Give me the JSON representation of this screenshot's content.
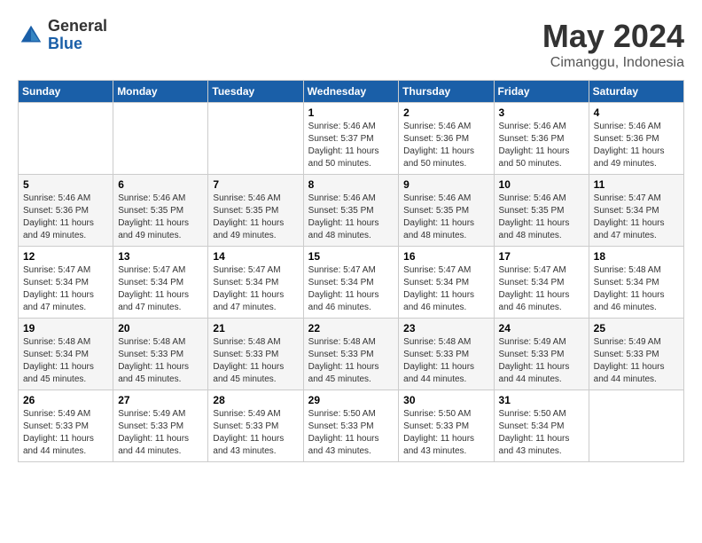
{
  "header": {
    "logo_general": "General",
    "logo_blue": "Blue",
    "month_title": "May 2024",
    "location": "Cimanggu, Indonesia"
  },
  "days_of_week": [
    "Sunday",
    "Monday",
    "Tuesday",
    "Wednesday",
    "Thursday",
    "Friday",
    "Saturday"
  ],
  "weeks": [
    [
      {
        "day": "",
        "info": ""
      },
      {
        "day": "",
        "info": ""
      },
      {
        "day": "",
        "info": ""
      },
      {
        "day": "1",
        "info": "Sunrise: 5:46 AM\nSunset: 5:37 PM\nDaylight: 11 hours\nand 50 minutes."
      },
      {
        "day": "2",
        "info": "Sunrise: 5:46 AM\nSunset: 5:36 PM\nDaylight: 11 hours\nand 50 minutes."
      },
      {
        "day": "3",
        "info": "Sunrise: 5:46 AM\nSunset: 5:36 PM\nDaylight: 11 hours\nand 50 minutes."
      },
      {
        "day": "4",
        "info": "Sunrise: 5:46 AM\nSunset: 5:36 PM\nDaylight: 11 hours\nand 49 minutes."
      }
    ],
    [
      {
        "day": "5",
        "info": "Sunrise: 5:46 AM\nSunset: 5:36 PM\nDaylight: 11 hours\nand 49 minutes."
      },
      {
        "day": "6",
        "info": "Sunrise: 5:46 AM\nSunset: 5:35 PM\nDaylight: 11 hours\nand 49 minutes."
      },
      {
        "day": "7",
        "info": "Sunrise: 5:46 AM\nSunset: 5:35 PM\nDaylight: 11 hours\nand 49 minutes."
      },
      {
        "day": "8",
        "info": "Sunrise: 5:46 AM\nSunset: 5:35 PM\nDaylight: 11 hours\nand 48 minutes."
      },
      {
        "day": "9",
        "info": "Sunrise: 5:46 AM\nSunset: 5:35 PM\nDaylight: 11 hours\nand 48 minutes."
      },
      {
        "day": "10",
        "info": "Sunrise: 5:46 AM\nSunset: 5:35 PM\nDaylight: 11 hours\nand 48 minutes."
      },
      {
        "day": "11",
        "info": "Sunrise: 5:47 AM\nSunset: 5:34 PM\nDaylight: 11 hours\nand 47 minutes."
      }
    ],
    [
      {
        "day": "12",
        "info": "Sunrise: 5:47 AM\nSunset: 5:34 PM\nDaylight: 11 hours\nand 47 minutes."
      },
      {
        "day": "13",
        "info": "Sunrise: 5:47 AM\nSunset: 5:34 PM\nDaylight: 11 hours\nand 47 minutes."
      },
      {
        "day": "14",
        "info": "Sunrise: 5:47 AM\nSunset: 5:34 PM\nDaylight: 11 hours\nand 47 minutes."
      },
      {
        "day": "15",
        "info": "Sunrise: 5:47 AM\nSunset: 5:34 PM\nDaylight: 11 hours\nand 46 minutes."
      },
      {
        "day": "16",
        "info": "Sunrise: 5:47 AM\nSunset: 5:34 PM\nDaylight: 11 hours\nand 46 minutes."
      },
      {
        "day": "17",
        "info": "Sunrise: 5:47 AM\nSunset: 5:34 PM\nDaylight: 11 hours\nand 46 minutes."
      },
      {
        "day": "18",
        "info": "Sunrise: 5:48 AM\nSunset: 5:34 PM\nDaylight: 11 hours\nand 46 minutes."
      }
    ],
    [
      {
        "day": "19",
        "info": "Sunrise: 5:48 AM\nSunset: 5:34 PM\nDaylight: 11 hours\nand 45 minutes."
      },
      {
        "day": "20",
        "info": "Sunrise: 5:48 AM\nSunset: 5:33 PM\nDaylight: 11 hours\nand 45 minutes."
      },
      {
        "day": "21",
        "info": "Sunrise: 5:48 AM\nSunset: 5:33 PM\nDaylight: 11 hours\nand 45 minutes."
      },
      {
        "day": "22",
        "info": "Sunrise: 5:48 AM\nSunset: 5:33 PM\nDaylight: 11 hours\nand 45 minutes."
      },
      {
        "day": "23",
        "info": "Sunrise: 5:48 AM\nSunset: 5:33 PM\nDaylight: 11 hours\nand 44 minutes."
      },
      {
        "day": "24",
        "info": "Sunrise: 5:49 AM\nSunset: 5:33 PM\nDaylight: 11 hours\nand 44 minutes."
      },
      {
        "day": "25",
        "info": "Sunrise: 5:49 AM\nSunset: 5:33 PM\nDaylight: 11 hours\nand 44 minutes."
      }
    ],
    [
      {
        "day": "26",
        "info": "Sunrise: 5:49 AM\nSunset: 5:33 PM\nDaylight: 11 hours\nand 44 minutes."
      },
      {
        "day": "27",
        "info": "Sunrise: 5:49 AM\nSunset: 5:33 PM\nDaylight: 11 hours\nand 44 minutes."
      },
      {
        "day": "28",
        "info": "Sunrise: 5:49 AM\nSunset: 5:33 PM\nDaylight: 11 hours\nand 43 minutes."
      },
      {
        "day": "29",
        "info": "Sunrise: 5:50 AM\nSunset: 5:33 PM\nDaylight: 11 hours\nand 43 minutes."
      },
      {
        "day": "30",
        "info": "Sunrise: 5:50 AM\nSunset: 5:33 PM\nDaylight: 11 hours\nand 43 minutes."
      },
      {
        "day": "31",
        "info": "Sunrise: 5:50 AM\nSunset: 5:34 PM\nDaylight: 11 hours\nand 43 minutes."
      },
      {
        "day": "",
        "info": ""
      }
    ]
  ]
}
